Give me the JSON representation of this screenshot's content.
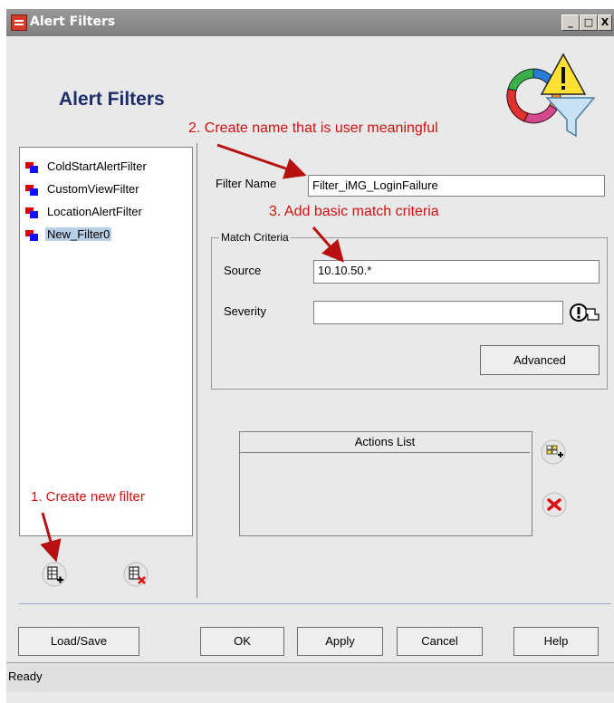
{
  "window": {
    "title": "Alert Filters"
  },
  "title_controls": {
    "minimize": "_",
    "maximize": "□",
    "close": "X"
  },
  "header": {
    "title": "Alert Filters"
  },
  "filters": [
    {
      "label": "ColdStartAlertFilter",
      "selected": false
    },
    {
      "label": "CustomViewFilter",
      "selected": false
    },
    {
      "label": "LocationAlertFilter",
      "selected": false
    },
    {
      "label": "New_Filter0",
      "selected": true
    }
  ],
  "form": {
    "filter_name_label": "Filter Name",
    "filter_name_value": "Filter_iMG_LoginFailure",
    "match_criteria_label": "Match Criteria",
    "source_label": "Source",
    "source_value": "10.10.50.*",
    "severity_label": "Severity",
    "severity_value": "",
    "advanced_label": "Advanced"
  },
  "actions": {
    "header": "Actions List"
  },
  "buttons": {
    "load_save": "Load/Save",
    "ok": "OK",
    "apply": "Apply",
    "cancel": "Cancel",
    "help": "Help"
  },
  "status": {
    "text": "Ready"
  },
  "annotations": {
    "step1": "1. Create new filter",
    "step2": "2. Create name that is user meaningful",
    "step3": "3. Add basic match criteria"
  },
  "colors": {
    "annotation": "#d01010",
    "title_blue": "#1c2e69",
    "selection": "#b8cfe5"
  }
}
